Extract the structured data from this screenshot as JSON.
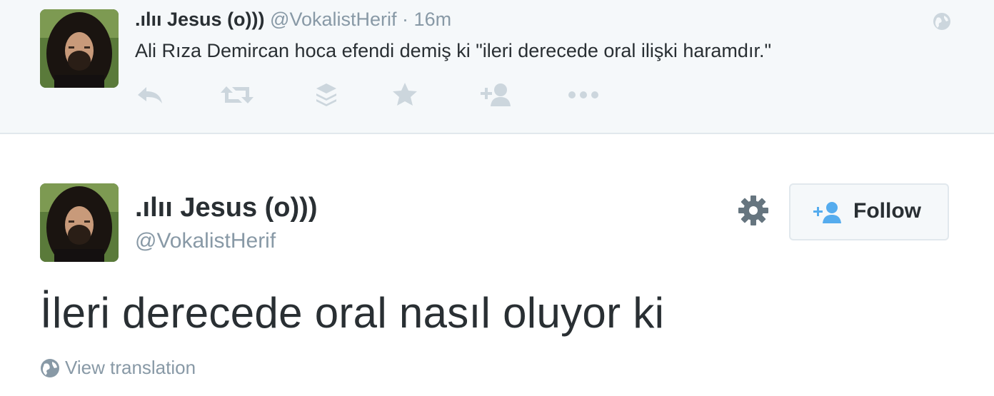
{
  "parent_tweet": {
    "name": ".ılıı Jesus (o)))",
    "handle": "@VokalistHerif",
    "separator": "·",
    "time": "16m",
    "text": "Ali Rıza Demircan hoca efendi demiş ki \"ileri derecede oral ilişki haramdır.\"",
    "actions": [
      "reply-icon",
      "retweet-icon",
      "buffer-icon",
      "favorite-icon",
      "follow-icon",
      "more-icon"
    ]
  },
  "main_tweet": {
    "name": ".ılıı Jesus (o)))",
    "handle": "@VokalistHerif",
    "text": "İleri derecede oral nasıl oluyor ki",
    "follow_label": "Follow",
    "view_translation": "View translation"
  },
  "colors": {
    "parent_bg": "#f5f8fa",
    "muted": "#8899a6",
    "text": "#292f33",
    "accent": "#55acee",
    "icon": "#ccd6dd"
  }
}
